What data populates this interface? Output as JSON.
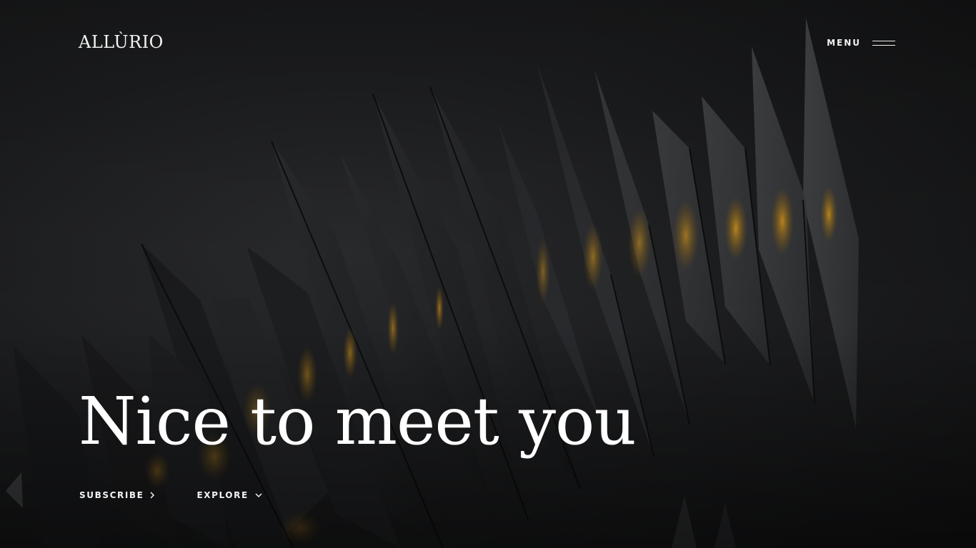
{
  "header": {
    "logo_text": "ALLÙRIO",
    "menu_label": "MENU",
    "menu_icon": "hamburger-icon"
  },
  "hero": {
    "headline": "Nice to meet you",
    "background": "dark abstract folded panels with amber glow",
    "actions": [
      {
        "label": "SUBSCRIBE",
        "icon": "chevron-right-icon"
      },
      {
        "label": "EXPLORE",
        "icon": "chevron-down-icon"
      }
    ]
  },
  "colors": {
    "background": "#141414",
    "text": "#ffffff",
    "accent_glow": "#c98a12"
  }
}
